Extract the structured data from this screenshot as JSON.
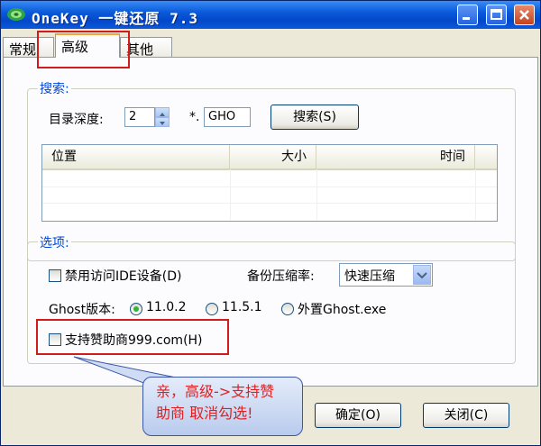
{
  "window": {
    "title": "OneKey 一键还原 7.3"
  },
  "tabs": [
    {
      "label": "常规"
    },
    {
      "label": "高级",
      "selected": true
    },
    {
      "label": "其他"
    }
  ],
  "search_group": {
    "label": "搜索:",
    "depth_label": "目录深度:",
    "depth_value": "2",
    "pattern_prefix": "*.",
    "pattern_value": "GHO",
    "search_button": "搜索(S)",
    "columns": [
      "位置",
      "大小",
      "时间"
    ],
    "rows": []
  },
  "options_group": {
    "label": "选项:",
    "disable_ide": {
      "label": "禁用访问IDE设备(D)",
      "checked": false
    },
    "compression_label": "备份压缩率:",
    "compression_value": "快速压缩",
    "ghost_version_label": "Ghost版本:",
    "ghost_versions": [
      {
        "label": "11.0.2",
        "selected": true
      },
      {
        "label": "11.5.1",
        "selected": false
      },
      {
        "label": "外置Ghost.exe",
        "selected": false
      }
    ],
    "sponsor": {
      "label": "支持赞助商999.com(H)",
      "checked": false
    }
  },
  "footer": {
    "ok_button": "确定(O)",
    "close_button": "关闭(C)"
  },
  "annotation": {
    "line1": "亲，高级->支持赞",
    "line2": "助商 取消勾选!"
  },
  "colors": {
    "accent_group_label": "#0046d5",
    "annotation_text": "#e02020",
    "highlight_box": "#d21c1c"
  }
}
